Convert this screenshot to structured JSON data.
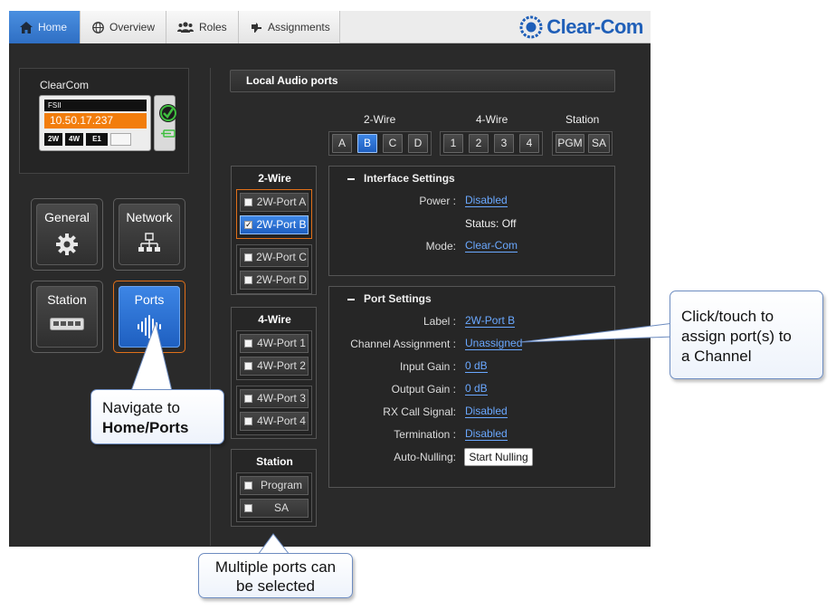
{
  "tabs": [
    {
      "label": "Home",
      "icon": "home-icon",
      "active": true
    },
    {
      "label": "Overview",
      "icon": "globe-icon",
      "active": false
    },
    {
      "label": "Roles",
      "icon": "users-icon",
      "active": false
    },
    {
      "label": "Assignments",
      "icon": "plug-icon",
      "active": false
    }
  ],
  "brand": {
    "name": "Clear-Com",
    "color": "#1f5fb8"
  },
  "device": {
    "name": "ClearCom",
    "model": "FSII",
    "ip": "10.50.17.237",
    "chips": [
      "2W",
      "4W",
      "E1"
    ],
    "status_icon": "check-circle-icon"
  },
  "nav": {
    "general": {
      "label": "General",
      "icon": "gear-icon"
    },
    "network": {
      "label": "Network",
      "icon": "network-icon"
    },
    "station": {
      "label": "Station",
      "icon": "station-icon"
    },
    "ports": {
      "label": "Ports",
      "icon": "audio-wave-icon",
      "active": true
    }
  },
  "local_audio": {
    "title": "Local Audio ports"
  },
  "selector": {
    "two_wire": {
      "label": "2-Wire",
      "buttons": [
        "A",
        "B",
        "C",
        "D"
      ],
      "selected": "B"
    },
    "four_wire": {
      "label": "4-Wire",
      "buttons": [
        "1",
        "2",
        "3",
        "4"
      ]
    },
    "station": {
      "label": "Station",
      "buttons": [
        "PGM",
        "SA"
      ]
    }
  },
  "port_list": {
    "two_wire": {
      "title": "2-Wire",
      "ports": [
        "2W-Port A",
        "2W-Port B",
        "2W-Port C",
        "2W-Port D"
      ],
      "checked": "2W-Port B"
    },
    "four_wire": {
      "title": "4-Wire",
      "ports": [
        "4W-Port 1",
        "4W-Port 2",
        "4W-Port 3",
        "4W-Port 4"
      ]
    },
    "station": {
      "title": "Station",
      "ports": [
        "Program",
        "SA"
      ]
    }
  },
  "interface_settings": {
    "title": "Interface Settings",
    "power_label": "Power :",
    "power_value": "Disabled",
    "status_text": "Status: Off",
    "mode_label": "Mode:",
    "mode_value": "Clear-Com"
  },
  "port_settings": {
    "title": "Port Settings",
    "rows": [
      {
        "label": "Label :",
        "value": "2W-Port B"
      },
      {
        "label": "Channel Assignment :",
        "value": "Unassigned"
      },
      {
        "label": "Input Gain :",
        "value": "0 dB"
      },
      {
        "label": "Output Gain :",
        "value": "0 dB"
      },
      {
        "label": "RX Call Signal:",
        "value": "Disabled"
      },
      {
        "label": "Termination :",
        "value": "Disabled"
      }
    ],
    "auto_nulling_label": "Auto-Nulling:",
    "start_nulling": "Start Nulling"
  },
  "callouts": {
    "channel": [
      "Click/touch to",
      "assign port(s) to",
      "a Channel"
    ],
    "navigate_line1": "Navigate to",
    "navigate_line2": "Home/Ports",
    "multiple": [
      "Multiple ports can",
      "be selected"
    ]
  },
  "colors": {
    "accent_blue": "#2f6fc4",
    "highlight_orange": "#e0701a",
    "link_blue": "#6aa8ff"
  }
}
